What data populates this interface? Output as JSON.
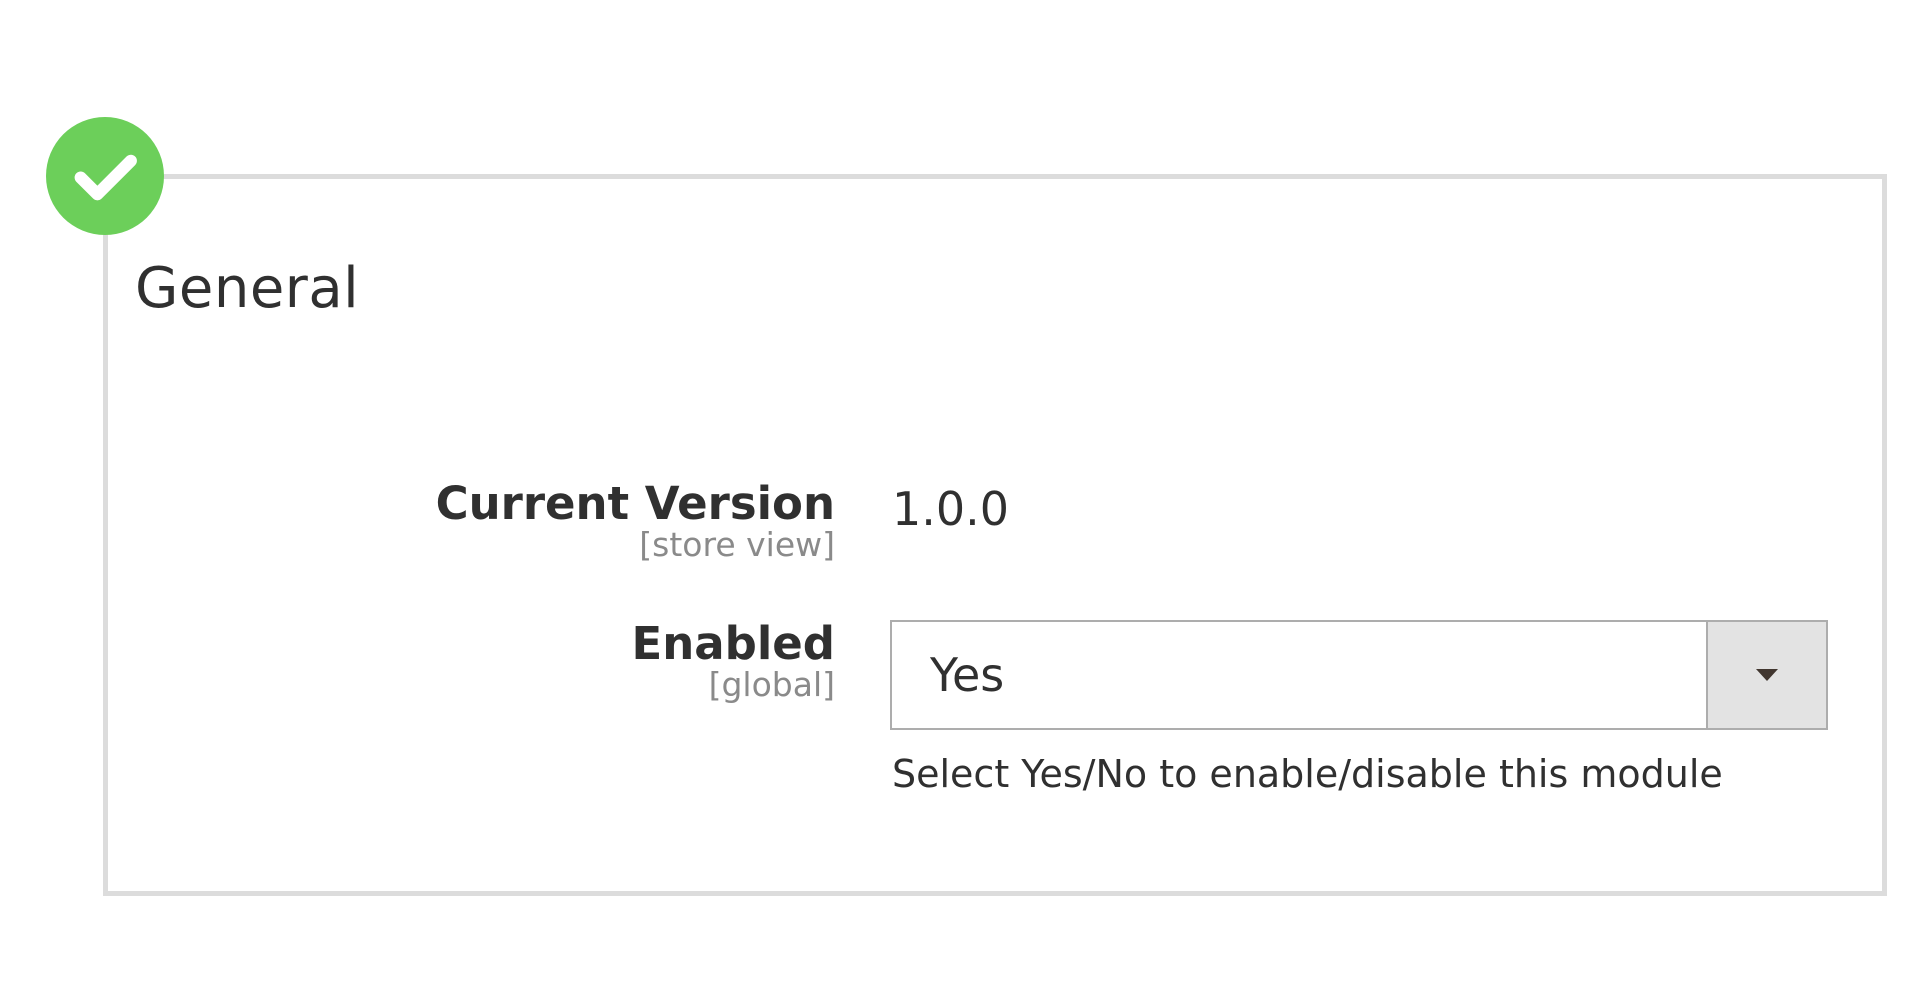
{
  "section": {
    "title": "General"
  },
  "fields": {
    "current_version": {
      "label": "Current Version",
      "scope": "[store view]",
      "value": "1.0.0"
    },
    "enabled": {
      "label": "Enabled",
      "scope": "[global]",
      "selected_value": "Yes",
      "help": "Select Yes/No to enable/disable this module"
    }
  },
  "icons": {
    "badge": "check-circle-icon",
    "dropdown": "chevron-down-icon"
  },
  "colors": {
    "success": "#6ccf5a",
    "border": "#dcdcdc",
    "text": "#303030",
    "muted": "#8a8a8a"
  }
}
